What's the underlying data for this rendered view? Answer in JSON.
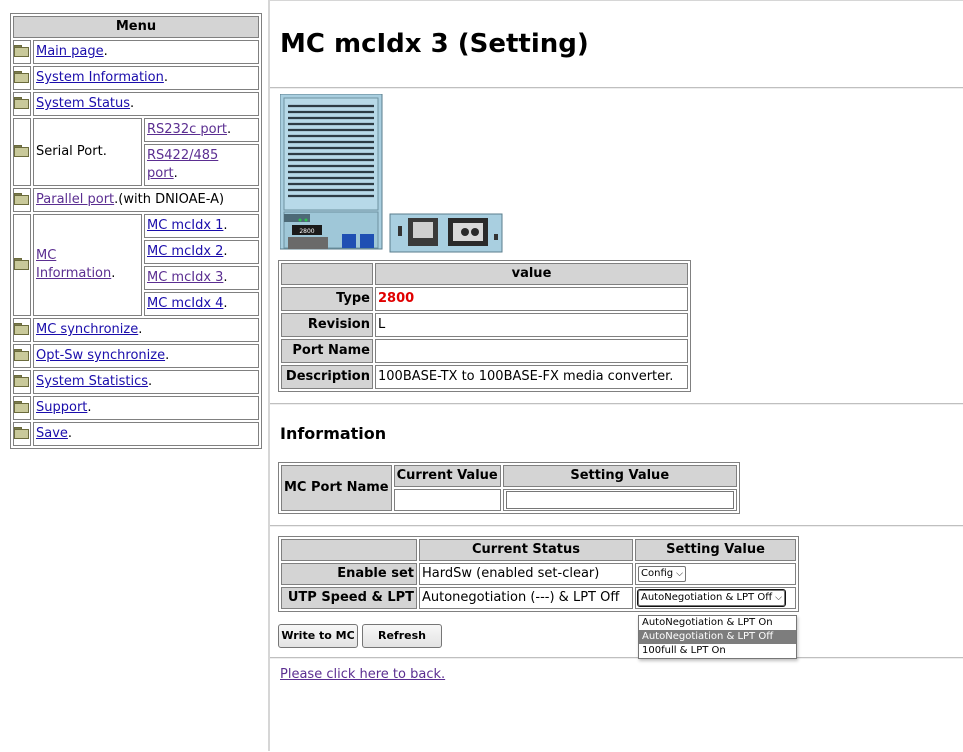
{
  "menu": {
    "header": "Menu",
    "main_page": "Main page",
    "system_information": "System Information",
    "system_status": "System Status",
    "serial_port": "Serial Port.",
    "rs232c": "RS232c port",
    "rs422_a": "RS422/485",
    "rs422_b": "port",
    "parallel_port": "Parallel port",
    "parallel_suffix": ".(with DNIOAE-A)",
    "mc_information_a": "MC",
    "mc_information_b": "Information",
    "mc_idx": [
      "MC mcIdx 1",
      "MC mcIdx 2",
      "MC mcIdx 3",
      "MC mcIdx 4"
    ],
    "mc_synchronize": "MC synchronize",
    "opt_sw_synchronize": "Opt-Sw synchronize",
    "system_statistics": "System Statistics",
    "support": "Support",
    "save": "Save",
    "dot": "."
  },
  "page": {
    "title": "MC mcIdx 3 (Setting)",
    "device_label": "2800"
  },
  "value_table": {
    "header": "value",
    "rows": [
      {
        "label": "Type",
        "value": "2800"
      },
      {
        "label": "Revision",
        "value": "L"
      },
      {
        "label": "Port Name",
        "value": ""
      },
      {
        "label": "Description",
        "value": "100BASE-TX to 100BASE-FX media converter."
      }
    ]
  },
  "information": {
    "heading": "Information",
    "col_name": "MC Port Name",
    "col_current": "Current Value",
    "col_setting": "Setting Value",
    "current_value": "",
    "setting_value": ""
  },
  "status_table": {
    "col_current": "Current Status",
    "col_setting": "Setting Value",
    "rows": [
      {
        "label": "Enable set",
        "current": "HardSw (enabled set-clear)",
        "setting": "Config"
      },
      {
        "label": "UTP Speed & LPT",
        "current": "Autonegotiation (---) & LPT Off",
        "setting": "AutoNegotiation & LPT Off"
      }
    ]
  },
  "dropdown": {
    "options": [
      "AutoNegotiation & LPT On",
      "AutoNegotiation & LPT Off",
      "100full & LPT On"
    ],
    "selected_index": 1
  },
  "buttons": {
    "write": "Write to MC",
    "refresh": "Refresh"
  },
  "back_link": "Please click here to back."
}
